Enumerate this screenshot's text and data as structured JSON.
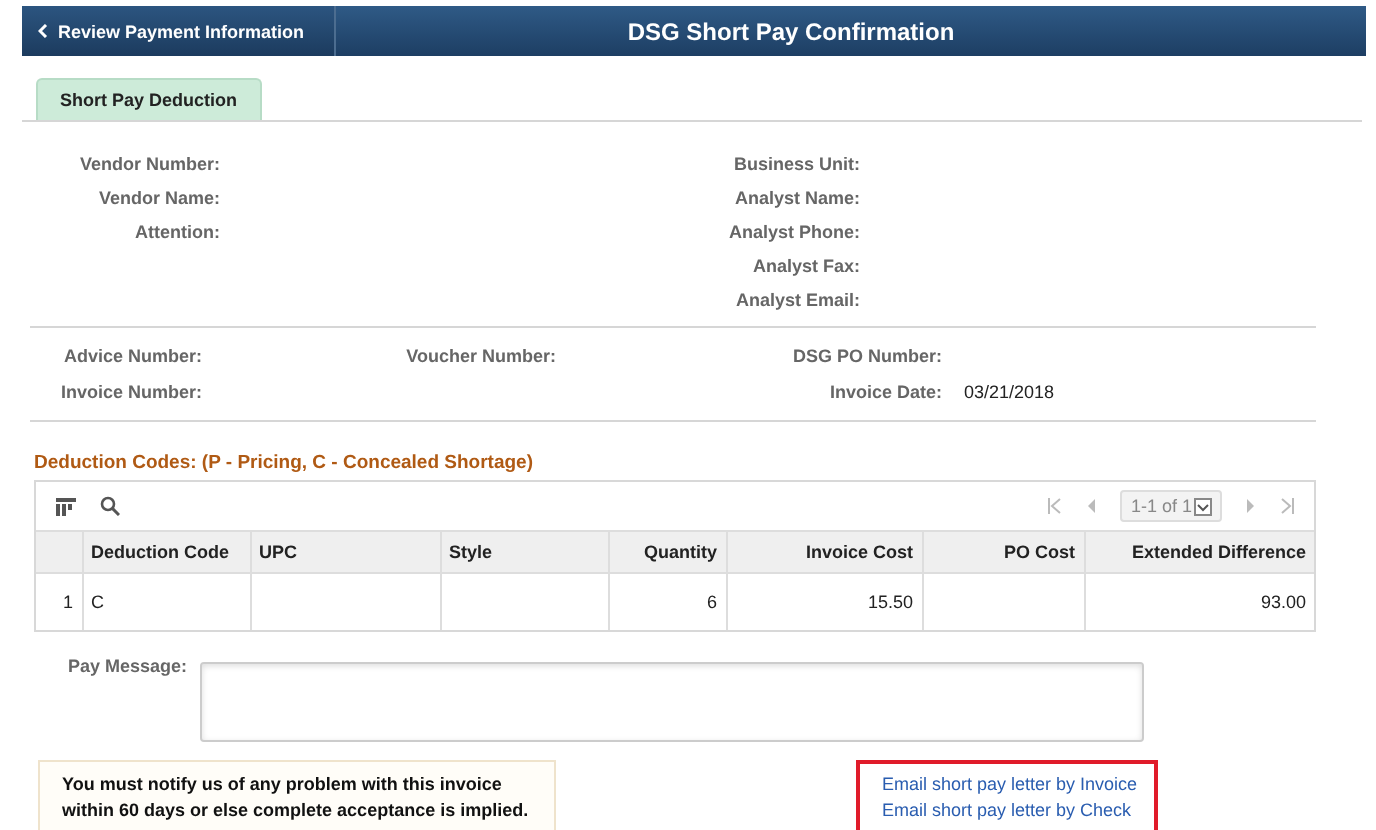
{
  "header": {
    "back_button": "Review Payment Information",
    "title": "DSG Short Pay Confirmation"
  },
  "tabs": [
    {
      "label": "Short Pay Deduction",
      "selected": true
    }
  ],
  "vendor_fields": {
    "left": [
      {
        "label": "Vendor Number:"
      },
      {
        "label": "Vendor Name:"
      },
      {
        "label": "Attention:"
      }
    ],
    "right": [
      {
        "label": "Business Unit:"
      },
      {
        "label": "Analyst Name:"
      },
      {
        "label": "Analyst Phone:"
      },
      {
        "label": "Analyst Fax:"
      },
      {
        "label": "Analyst Email:"
      }
    ]
  },
  "invoice_fields": [
    [
      {
        "label": "Advice Number:"
      },
      {
        "label": "Invoice Number:"
      }
    ],
    [
      {
        "label": "Voucher Number:"
      }
    ],
    [
      {
        "label": "DSG PO Number:"
      },
      {
        "label": "Invoice Date:",
        "value": "03/21/2018"
      }
    ]
  ],
  "deduction_grid": {
    "title": "Deduction Codes: (P - Pricing, C - Concealed Shortage)",
    "pager": "1-1 of 1",
    "columns": [
      "Deduction Code",
      "UPC",
      "Style",
      "Quantity",
      "Invoice Cost",
      "PO Cost",
      "Extended Difference"
    ],
    "rows": [
      {
        "number": "1",
        "cells": [
          "C",
          "",
          "",
          "6",
          "15.50",
          "",
          "93.00"
        ]
      }
    ]
  },
  "pay_message": {
    "label": "Pay Message:"
  },
  "notice": "You must notify us of any problem with this invoice within 60 days or else complete acceptance is implied.",
  "links": [
    "Email short pay letter by Invoice",
    "Email short pay letter by Check"
  ]
}
